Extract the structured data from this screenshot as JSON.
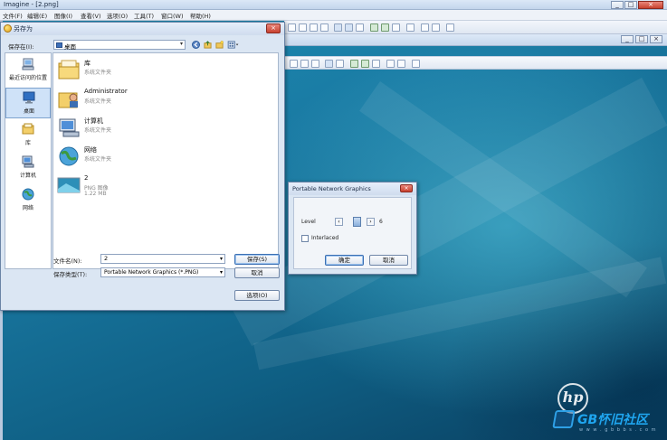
{
  "app": {
    "title": "Imagine - [2.png]",
    "menu": [
      "文件(F)",
      "编辑(E)",
      "图像(I)",
      "查看(V)",
      "选项(O)",
      "工具(T)",
      "窗口(W)",
      "帮助(H)"
    ],
    "window_controls": {
      "minimize": "_",
      "maximize": "□",
      "close": "×"
    }
  },
  "save_dialog": {
    "title": "另存为",
    "close_glyph": "×",
    "look_in_label": "保存在(I):",
    "look_in_value": "桌面",
    "places": [
      {
        "label": "最近访问的位置",
        "icon": "recent-places-icon"
      },
      {
        "label": "桌面",
        "icon": "desktop-icon"
      },
      {
        "label": "库",
        "icon": "libraries-icon"
      },
      {
        "label": "计算机",
        "icon": "computer-icon"
      },
      {
        "label": "网络",
        "icon": "network-icon"
      }
    ],
    "files": [
      {
        "name": "库",
        "type": "系统文件夹",
        "size": "",
        "icon": "library-folder-icon"
      },
      {
        "name": "Administrator",
        "type": "系统文件夹",
        "size": "",
        "icon": "user-folder-icon"
      },
      {
        "name": "计算机",
        "type": "系统文件夹",
        "size": "",
        "icon": "computer-icon"
      },
      {
        "name": "网络",
        "type": "系统文件夹",
        "size": "",
        "icon": "network-icon"
      },
      {
        "name": "2",
        "type": "PNG 图像",
        "size": "1.22 MB",
        "icon": "png-file-icon"
      }
    ],
    "filename_label": "文件名(N):",
    "filename_value": "2",
    "filetype_label": "保存类型(T):",
    "filetype_value": "Portable Network Graphics (*.PNG)",
    "save_button": "保存(S)",
    "cancel_button": "取消",
    "options_button": "选项(O)"
  },
  "png_dialog": {
    "title": "Portable Network Graphics",
    "close_glyph": "×",
    "level_label": "Level",
    "level_value": "6",
    "interlaced_label": "Interlaced",
    "interlaced_checked": false,
    "ok_button": "确定",
    "cancel_button": "取消"
  },
  "watermark": {
    "hp": "hp",
    "site": "GB怀旧社区",
    "sub": "w w w . g b b b s . c o m"
  }
}
